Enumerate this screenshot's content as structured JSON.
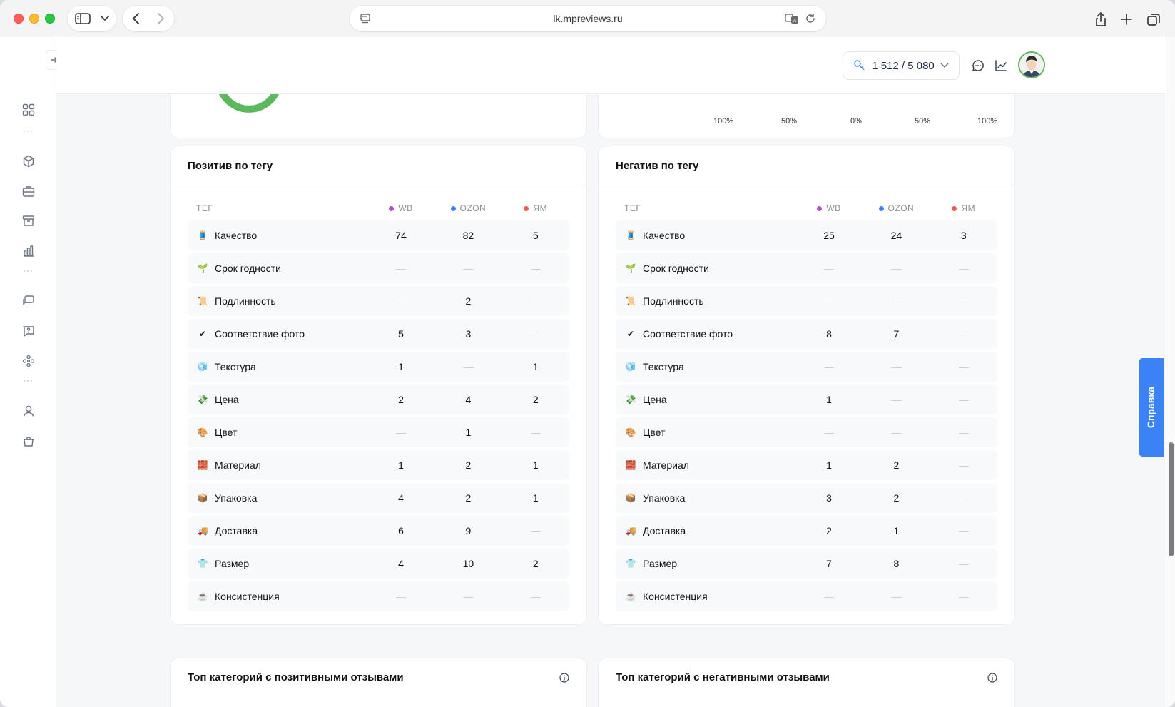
{
  "browser": {
    "url": "lk.mpreviews.ru"
  },
  "topbar": {
    "quota": "1 512 / 5 080"
  },
  "top_axis": [
    "100%",
    "50%",
    "0%",
    "50%",
    "100%"
  ],
  "columns": {
    "tag": "ТЕГ",
    "wb": "WB",
    "ozon": "OZON",
    "ym": "ЯМ"
  },
  "colors": {
    "wb": "#b44fd0",
    "ozon": "#3b82f6",
    "ym": "#ef5b4e",
    "accent": "#3b82f6",
    "positive": "#5cb85c"
  },
  "positive": {
    "title": "Позитив по тегу",
    "rows": [
      {
        "icon": "🧵",
        "tag": "Качество",
        "wb": "74",
        "ozon": "82",
        "ym": "5"
      },
      {
        "icon": "🌱",
        "tag": "Срок годности",
        "wb": "—",
        "ozon": "—",
        "ym": "—"
      },
      {
        "icon": "📜",
        "tag": "Подлинность",
        "wb": "—",
        "ozon": "2",
        "ym": "—"
      },
      {
        "icon": "✔",
        "tag": "Соответствие фото",
        "wb": "5",
        "ozon": "3",
        "ym": "—"
      },
      {
        "icon": "🧊",
        "tag": "Текстура",
        "wb": "1",
        "ozon": "—",
        "ym": "1"
      },
      {
        "icon": "💸",
        "tag": "Цена",
        "wb": "2",
        "ozon": "4",
        "ym": "2"
      },
      {
        "icon": "🎨",
        "tag": "Цвет",
        "wb": "—",
        "ozon": "1",
        "ym": "—"
      },
      {
        "icon": "🧱",
        "tag": "Материал",
        "wb": "1",
        "ozon": "2",
        "ym": "1"
      },
      {
        "icon": "📦",
        "tag": "Упаковка",
        "wb": "4",
        "ozon": "2",
        "ym": "1"
      },
      {
        "icon": "🚚",
        "tag": "Доставка",
        "wb": "6",
        "ozon": "9",
        "ym": "—"
      },
      {
        "icon": "👕",
        "tag": "Размер",
        "wb": "4",
        "ozon": "10",
        "ym": "2"
      },
      {
        "icon": "☕",
        "tag": "Консистенция",
        "wb": "—",
        "ozon": "—",
        "ym": "—"
      }
    ]
  },
  "negative": {
    "title": "Негатив по тегу",
    "rows": [
      {
        "icon": "🧵",
        "tag": "Качество",
        "wb": "25",
        "ozon": "24",
        "ym": "3"
      },
      {
        "icon": "🌱",
        "tag": "Срок годности",
        "wb": "—",
        "ozon": "—",
        "ym": "—"
      },
      {
        "icon": "📜",
        "tag": "Подлинность",
        "wb": "—",
        "ozon": "—",
        "ym": "—"
      },
      {
        "icon": "✔",
        "tag": "Соответствие фото",
        "wb": "8",
        "ozon": "7",
        "ym": "—"
      },
      {
        "icon": "🧊",
        "tag": "Текстура",
        "wb": "—",
        "ozon": "—",
        "ym": "—"
      },
      {
        "icon": "💸",
        "tag": "Цена",
        "wb": "1",
        "ozon": "—",
        "ym": "—"
      },
      {
        "icon": "🎨",
        "tag": "Цвет",
        "wb": "—",
        "ozon": "—",
        "ym": "—"
      },
      {
        "icon": "🧱",
        "tag": "Материал",
        "wb": "1",
        "ozon": "2",
        "ym": "—"
      },
      {
        "icon": "📦",
        "tag": "Упаковка",
        "wb": "3",
        "ozon": "2",
        "ym": "—"
      },
      {
        "icon": "🚚",
        "tag": "Доставка",
        "wb": "2",
        "ozon": "1",
        "ym": "—"
      },
      {
        "icon": "👕",
        "tag": "Размер",
        "wb": "7",
        "ozon": "8",
        "ym": "—"
      },
      {
        "icon": "☕",
        "tag": "Консистенция",
        "wb": "—",
        "ozon": "—",
        "ym": "—"
      }
    ]
  },
  "top_positive_title": "Топ категорий с позитивными отзывами",
  "top_negative_title": "Топ категорий с негативными отзывами",
  "help_label": "Справка"
}
